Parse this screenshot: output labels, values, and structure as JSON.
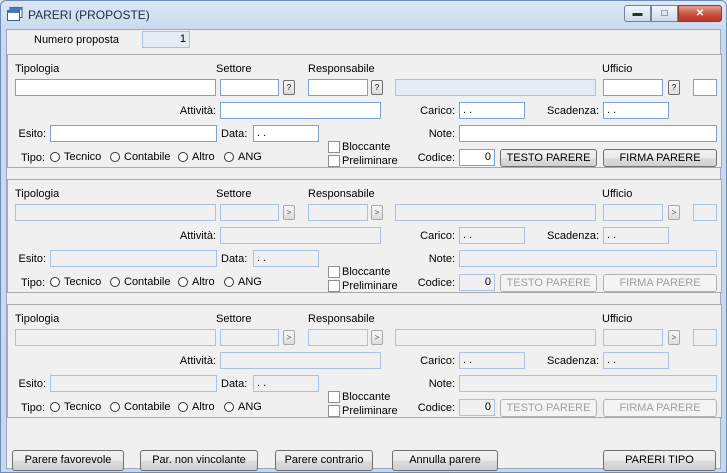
{
  "window": {
    "title": "PARERI (PROPOSTE)",
    "controls": [
      "minimize",
      "maximize",
      "close"
    ]
  },
  "header": {
    "numero_proposta_label": "Numero proposta",
    "numero_proposta_value": "1"
  },
  "labels": {
    "tipologia": "Tipologia",
    "settore": "Settore",
    "responsabile": "Responsabile",
    "ufficio": "Ufficio",
    "attivita": "Attività:",
    "carico": "Carico:",
    "scadenza": "Scadenza:",
    "esito": "Esito:",
    "data": "Data:",
    "note": "Note:",
    "tipo": "Tipo:",
    "codice": "Codice:",
    "bloccante": "Bloccante",
    "preliminare": "Preliminare",
    "lookup": "?",
    "radio_tecnico": "Tecnico",
    "radio_contabile": "Contabile",
    "radio_altro": "Altro",
    "radio_ang": "ANG",
    "testo_parere": "TESTO PARERE",
    "firma_parere": "FIRMA PARERE"
  },
  "panels": [
    {
      "enabled": true,
      "carico": ". .",
      "scadenza": ". .",
      "data": ". .",
      "codice": "0"
    },
    {
      "enabled": false,
      "carico": ". .",
      "scadenza": ". .",
      "data": ". .",
      "codice": "0"
    },
    {
      "enabled": false,
      "carico": ". .",
      "scadenza": ". .",
      "data": ". .",
      "codice": "0"
    }
  ],
  "footer": {
    "parere_favorevole": "Parere favorevole",
    "par_non_vincolante": "Par. non vincolante",
    "parere_contrario": "Parere contrario",
    "annulla_parere": "Annulla parere",
    "pareri_tipo": "PARERI TIPO"
  },
  "colors": {
    "title_bar": "#c9d9ee",
    "field_border": "#7aa2d6",
    "close_button": "#c9503b"
  }
}
